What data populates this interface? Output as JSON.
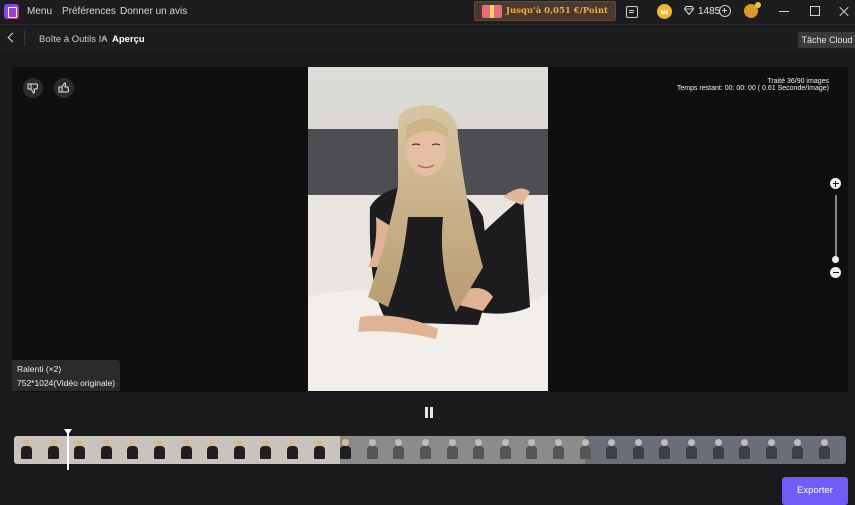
{
  "titlebar": {
    "menu": [
      "Menu",
      "Préférences",
      "Donner un avis"
    ],
    "promo_text": "Jusqu'à 0,051 €/Point",
    "gem_count": "1485",
    "icons": [
      "app-logo-icon",
      "gift-icon",
      "chat-icon",
      "crown-icon",
      "gem-icon",
      "add-credits-icon",
      "account-icon"
    ]
  },
  "nav": {
    "breadcrumb_link": "Boîte à Outils IA",
    "breadcrumb_arrow": ">",
    "breadcrumb_current": "Aperçu",
    "cloud_button": "Tâche Cloud"
  },
  "preview": {
    "status_line1": "Traité 36/90 images",
    "status_line2": "Temps restant: 00: 00: 00 ( 0.61 Seconde/Image)",
    "info_mode": "Ralenti (×2)",
    "info_resolution": "752*1024(Vidéo originale)",
    "zoom_level_fraction": 0.9
  },
  "timeline": {
    "processed_fraction": 0.4,
    "playhead_fraction": 0.064
  },
  "footer": {
    "export_button": "Exporter"
  },
  "colors": {
    "accent": "#6f5bf6",
    "promo_text": "#f0a94a",
    "background": "#1a1a1c"
  }
}
